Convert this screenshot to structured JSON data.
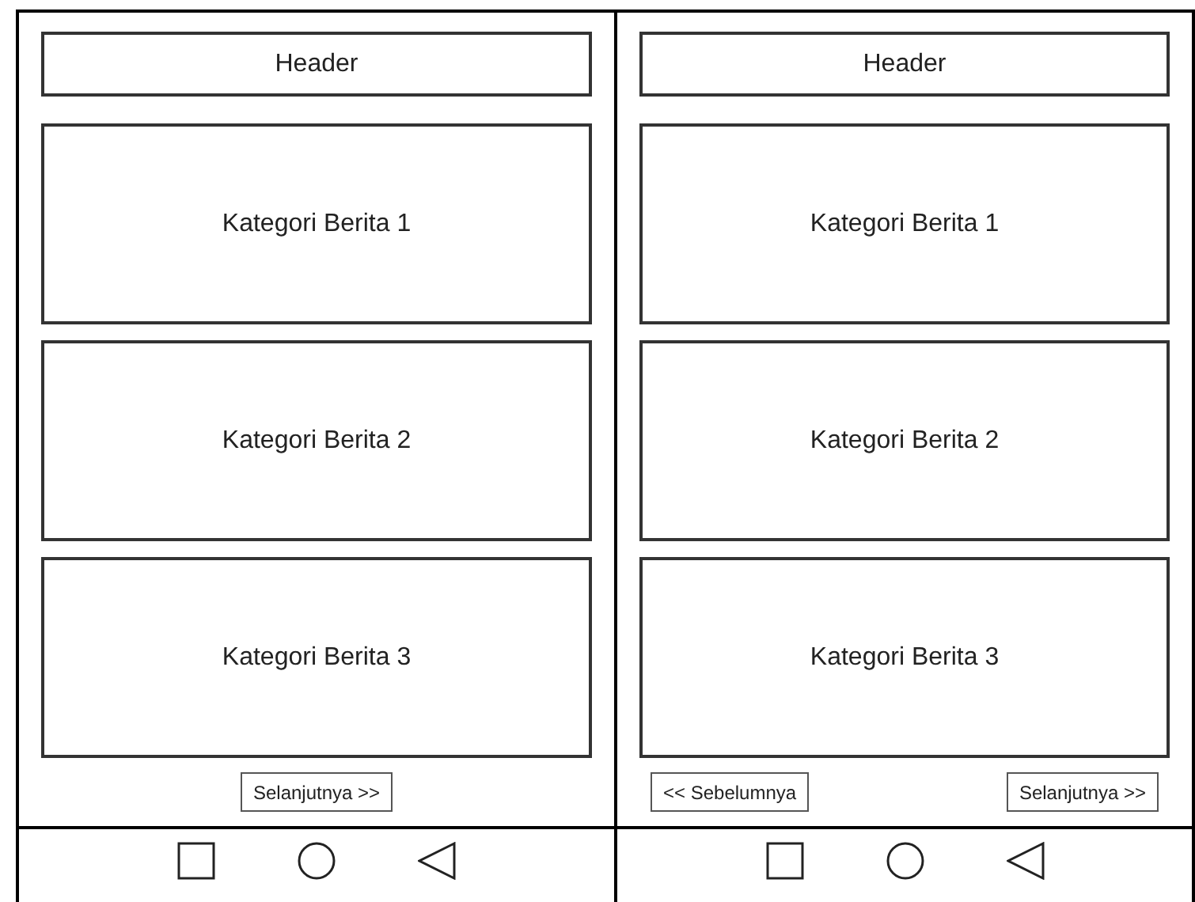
{
  "screens": [
    {
      "header": "Header",
      "categories": [
        "Kategori Berita 1",
        "Kategori Berita 2",
        "Kategori Berita 3"
      ],
      "buttons": [
        "Selanjutnya >>"
      ]
    },
    {
      "header": "Header",
      "categories": [
        "Kategori Berita 1",
        "Kategori Berita 2",
        "Kategori Berita 3"
      ],
      "buttons": [
        "<< Sebelumnya",
        "Selanjutnya >>"
      ]
    }
  ]
}
